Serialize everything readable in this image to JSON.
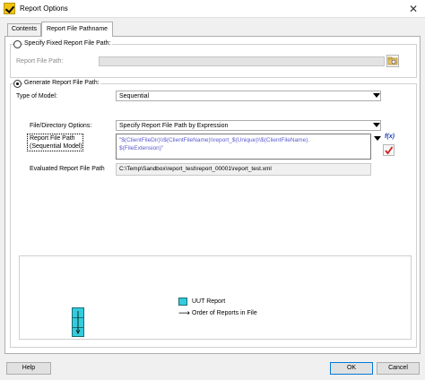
{
  "window": {
    "title": "Report Options",
    "close_glyph": "✕"
  },
  "tabs": [
    {
      "label": "Contents",
      "active": false
    },
    {
      "label": "Report File Pathname",
      "active": true
    }
  ],
  "fixed_path": {
    "option_label": "Specify Fixed Report File Path:",
    "field_label": "Report File Path:",
    "value": "",
    "browse_icon": "folder-browse-icon"
  },
  "generate_path": {
    "option_label": "Generate Report File Path:",
    "type_of_model_label": "Type of Model:",
    "type_of_model_value": "Sequential",
    "file_dir_options_label": "File/Directory Options:",
    "file_dir_options_value": "Specify Report File Path by Expression",
    "report_file_path_label_line1": "Report File Path",
    "report_file_path_label_line2": "(Sequential Model)",
    "expression_line1": "\"$(ClientFileDir)\\\\$(ClientFileName)\\\\report_$(Unique)\\\\$(ClientFileName).",
    "expression_line2": "$(FileExtension)\"",
    "fx_label": "f(x)",
    "evaluated_label": "Evaluated Report File Path",
    "evaluated_value": "C:\\Temp\\Sandbox\\report_test\\report_00001\\report_test.xml"
  },
  "diagram": {
    "legend_uut": "UUT Report",
    "legend_order": "Order of Reports in File",
    "arrow_glyph": "⟶",
    "uut_color": "#33ccdd"
  },
  "buttons": {
    "help": "Help",
    "ok": "OK",
    "cancel": "Cancel"
  }
}
